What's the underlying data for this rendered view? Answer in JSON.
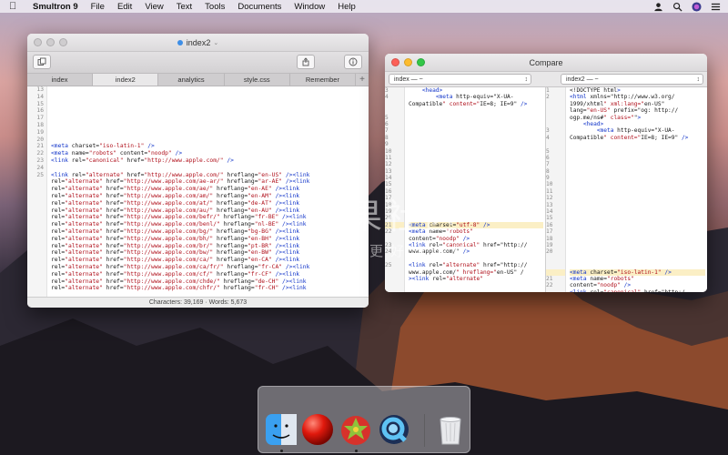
{
  "menubar": {
    "app_name": "Smultron 9",
    "items": [
      "File",
      "Edit",
      "View",
      "Text",
      "Tools",
      "Documents",
      "Window",
      "Help"
    ]
  },
  "editor": {
    "title": "index2",
    "tabs": [
      "index",
      "index2",
      "analytics",
      "style.css",
      "Remember",
      "+"
    ],
    "active_tab": "index2",
    "line_numbers": [
      "13",
      "14",
      "15",
      "16",
      "17",
      "18",
      "19",
      "20",
      "21",
      "22",
      "23",
      "24",
      "25",
      "",
      "",
      "",
      "",
      "",
      "",
      "",
      "",
      "",
      "",
      "",
      "",
      "",
      ""
    ],
    "code_lines": [
      "",
      "",
      "",
      "",
      "",
      "",
      "",
      "",
      "<meta charset=\"iso-latin-1\" />",
      "<meta name=\"robots\" content=\"noodp\" />",
      "<link rel=\"canonical\" href=\"http://www.apple.com/\" />",
      "",
      "<link rel=\"alternate\" href=\"http://www.apple.com/\" hreflang=\"en-US\" /><link",
      "rel=\"alternate\" href=\"http://www.apple.com/ae-ar/\" hreflang=\"ar-AE\" /><link",
      "rel=\"alternate\" href=\"http://www.apple.com/ae/\" hreflang=\"en-AE\" /><link",
      "rel=\"alternate\" href=\"http://www.apple.com/am/\" hreflang=\"en-AM\" /><link",
      "rel=\"alternate\" href=\"http://www.apple.com/at/\" hreflang=\"de-AT\" /><link",
      "rel=\"alternate\" href=\"http://www.apple.com/au/\" hreflang=\"en-AU\" /><link",
      "rel=\"alternate\" href=\"http://www.apple.com/befr/\" hreflang=\"fr-BE\" /><link",
      "rel=\"alternate\" href=\"http://www.apple.com/benl/\" hreflang=\"nl-BE\" /><link",
      "rel=\"alternate\" href=\"http://www.apple.com/bg/\" hreflang=\"bg-BG\" /><link",
      "rel=\"alternate\" href=\"http://www.apple.com/bh/\" hreflang=\"en-BH\" /><link",
      "rel=\"alternate\" href=\"http://www.apple.com/br/\" hreflang=\"pt-BR\" /><link",
      "rel=\"alternate\" href=\"http://www.apple.com/bw/\" hreflang=\"en-BW\" /><link",
      "rel=\"alternate\" href=\"http://www.apple.com/ca/\" hreflang=\"en-CA\" /><link",
      "rel=\"alternate\" href=\"http://www.apple.com/ca/fr/\" hreflang=\"fr-CA\" /><link",
      "rel=\"alternate\" href=\"http://www.apple.com/cf/\" hreflang=\"fr-CF\" /><link",
      "rel=\"alternate\" href=\"http://www.apple.com/chde/\" hreflang=\"de-CH\" /><link",
      "rel=\"alternate\" href=\"http://www.apple.com/chfr/\" hreflang=\"fr-CH\" /><link"
    ],
    "status": "Characters: 39,169 · Words: 5,673"
  },
  "compare": {
    "title": "Compare",
    "left_select": "index — ~",
    "right_select": "index2 — ~",
    "left_gutter": [
      "3",
      "4",
      "",
      "",
      "5",
      "6",
      "7",
      "8",
      "9",
      "10",
      "11",
      "12",
      "13",
      "14",
      "15",
      "16",
      "17",
      "18",
      "19",
      "20",
      "21",
      "22",
      "",
      "23",
      "24",
      "",
      "25",
      "",
      ""
    ],
    "left_lines": [
      "    <head>",
      "        <meta http-equiv=\"X-UA-",
      "Compatible\" content=\"IE=8; IE=9\" />",
      "",
      "",
      "",
      "",
      "",
      "",
      "",
      "",
      "",
      "",
      "",
      "",
      "",
      "",
      "",
      "",
      "",
      "<meta charset=\"utf-8\" />",
      "<meta name=\"robots\"",
      "content=\"noodp\" />",
      "<link rel=\"canonical\" href=\"http://",
      "www.apple.com/\" />",
      "",
      "<link rel=\"alternate\" href=\"http://",
      "www.apple.com/\" hreflang=\"en-US\" /",
      "><link rel=\"alternate\""
    ],
    "right_gutter": [
      "1",
      "2",
      "",
      "",
      "",
      "",
      "3",
      "4",
      "",
      "5",
      "6",
      "7",
      "8",
      "9",
      "10",
      "11",
      "12",
      "13",
      "14",
      "15",
      "16",
      "17",
      "18",
      "19",
      "20",
      "",
      "",
      "",
      "21",
      "22",
      ""
    ],
    "right_lines": [
      "<!DOCTYPE html>",
      "<html xmlns=\"http://www.w3.org/",
      "1999/xhtml\" xml:lang=\"en-US\"",
      "lang=\"en-US\" prefix=\"og: http://",
      "ogp.me/ns#\" class=\"\">",
      "    <head>",
      "        <meta http-equiv=\"X-UA-",
      "Compatible\" content=\"IE=8; IE=9\" />",
      "",
      "",
      "",
      "",
      "",
      "",
      "",
      "",
      "",
      "",
      "",
      "",
      "",
      "",
      "",
      "",
      "",
      "",
      "",
      "<meta charset=\"iso-latin-1\" />",
      "<meta name=\"robots\"",
      "content=\"noodp\" />",
      "<link rel=\"canonical\" href=\"http:/"
    ]
  },
  "watermark": {
    "line1": "苹果社区",
    "line2": "只为更好的体验"
  },
  "dock": {
    "apps": [
      "finder-icon",
      "red-ball-app-icon",
      "smultron-icon",
      "quicktime-icon",
      "trash-icon"
    ]
  },
  "colors": {
    "tag_blue": "#1134c9",
    "string_red": "#b0111c",
    "highlight": "#fbefc5"
  }
}
